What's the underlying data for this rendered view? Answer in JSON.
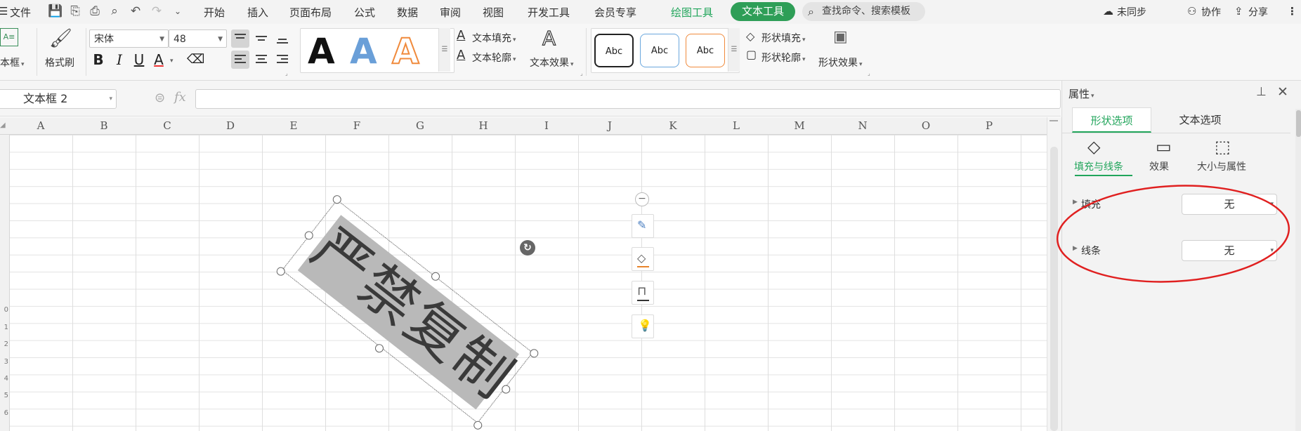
{
  "menubar": {
    "file_label": "文件",
    "tabs": [
      "开始",
      "插入",
      "页面布局",
      "公式",
      "数据",
      "审阅",
      "视图",
      "开发工具",
      "会员专享"
    ],
    "drawing_tools": "绘图工具",
    "text_tools": "文本工具",
    "search_placeholder": "查找命令、搜索模板",
    "sync": "未同步",
    "collab": "协作",
    "share": "分享"
  },
  "ribbon": {
    "textbox_label": "本框",
    "format_painter": "格式刷",
    "font_name": "宋体",
    "font_size": "48",
    "bold": "B",
    "italic": "I",
    "underline": "U",
    "font_color_glyph": "A",
    "style_glyph": "A",
    "text_fill": "文本填充",
    "text_outline": "文本轮廓",
    "text_effect": "文本效果",
    "shape_style_label": "Abc",
    "shape_fill": "形状填充",
    "shape_outline": "形状轮廓",
    "shape_effect": "形状效果"
  },
  "formula_bar": {
    "name_box": "文本框 2",
    "fx": "fx",
    "value": ""
  },
  "sheet": {
    "columns": [
      "A",
      "B",
      "C",
      "D",
      "E",
      "F",
      "G",
      "H",
      "I",
      "J",
      "K",
      "L",
      "M",
      "N",
      "O",
      "P"
    ],
    "row_labels": [
      "0",
      "1",
      "2",
      "3",
      "4",
      "5",
      "6"
    ],
    "watermark_text": "严禁复制"
  },
  "panel": {
    "title": "属性",
    "tab_shape": "形状选项",
    "tab_text": "文本选项",
    "sub_fill_line": "填充与线条",
    "sub_effect": "效果",
    "sub_size": "大小与属性",
    "fill_label": "填充",
    "fill_value": "无",
    "line_label": "线条",
    "line_value": "无"
  },
  "colors": {
    "accent_green": "#21a55b",
    "pill_green": "#2e9e57",
    "annotation_red": "#e02020",
    "shape_fill": "#b9b9b9"
  }
}
